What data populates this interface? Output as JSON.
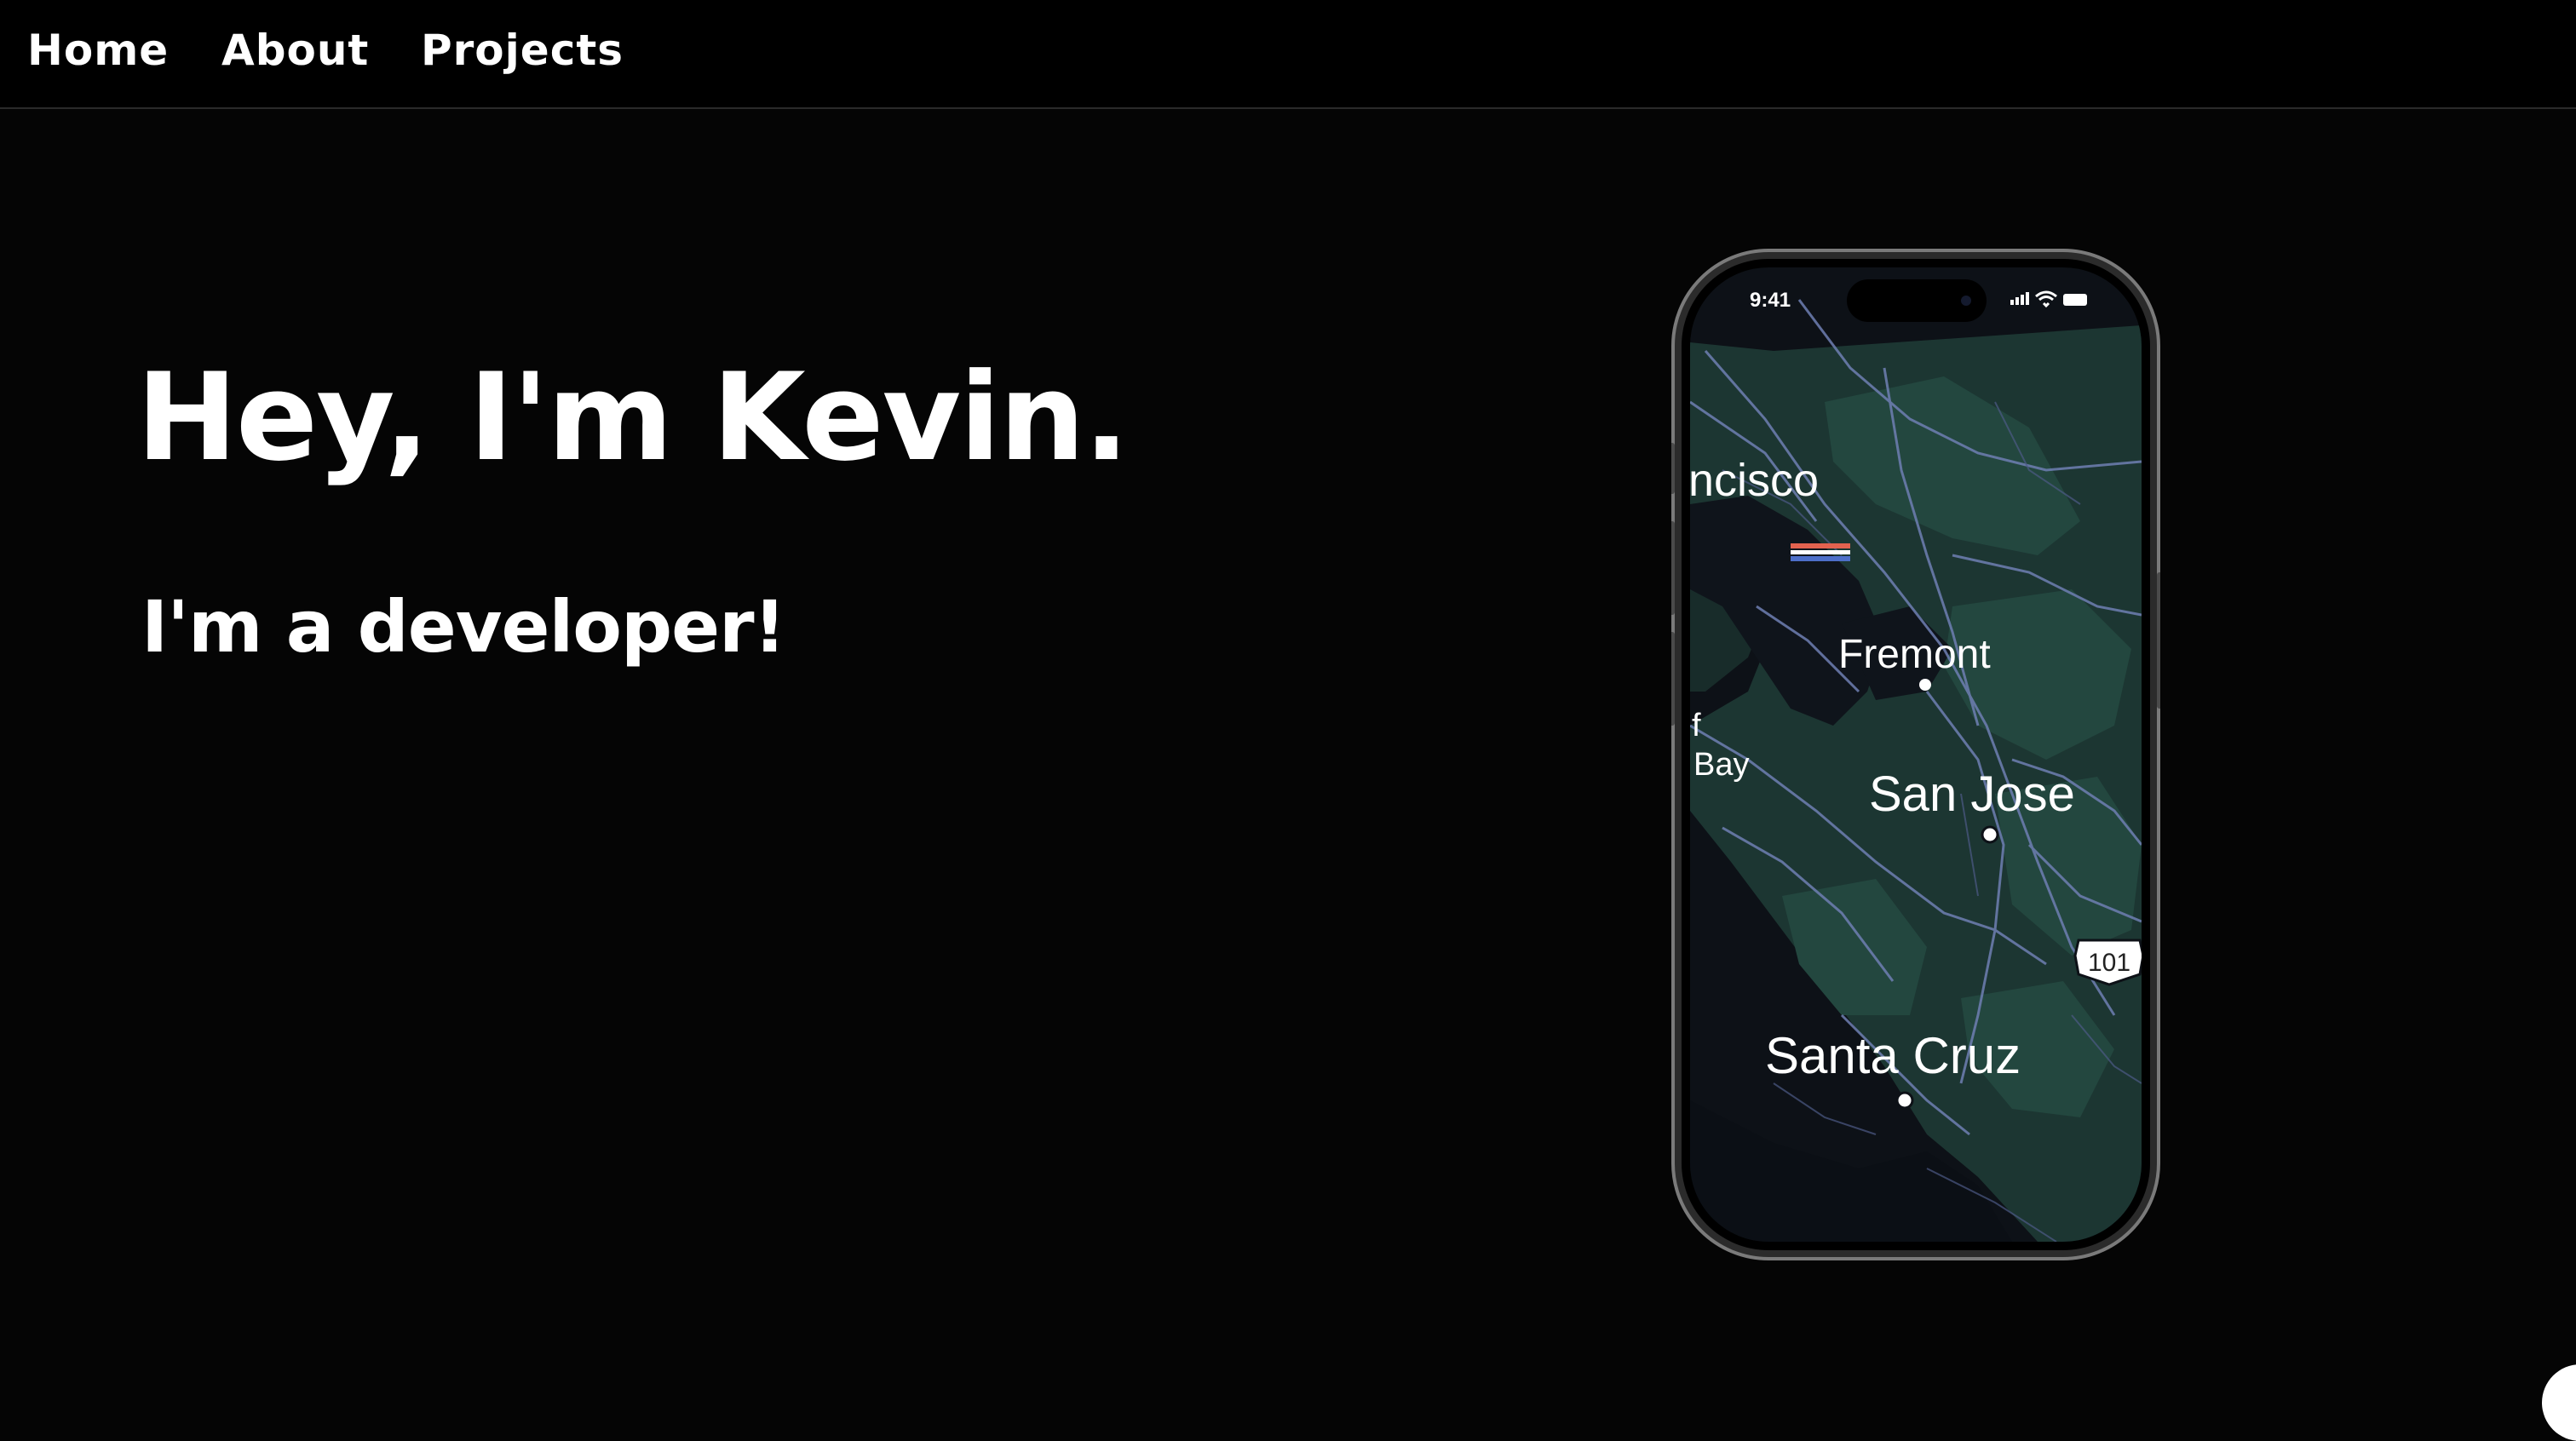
{
  "nav": {
    "items": [
      {
        "label": "Home"
      },
      {
        "label": "About"
      },
      {
        "label": "Projects"
      }
    ]
  },
  "hero": {
    "title": "Hey, I'm Kevin.",
    "subtitle": "I'm a developer!"
  },
  "phone": {
    "status_time": "9:41",
    "map_labels": {
      "city_1": "ncisco",
      "city_2": "Fremont",
      "city_3": "f",
      "city_4": "Bay",
      "city_5": "San Jose",
      "city_6": "Santa Cruz",
      "highway": "101"
    }
  },
  "colors": {
    "background": "#050505",
    "map_land": "#1e3a36",
    "map_water": "#0d1117",
    "map_roads": "#6f7fb3"
  }
}
